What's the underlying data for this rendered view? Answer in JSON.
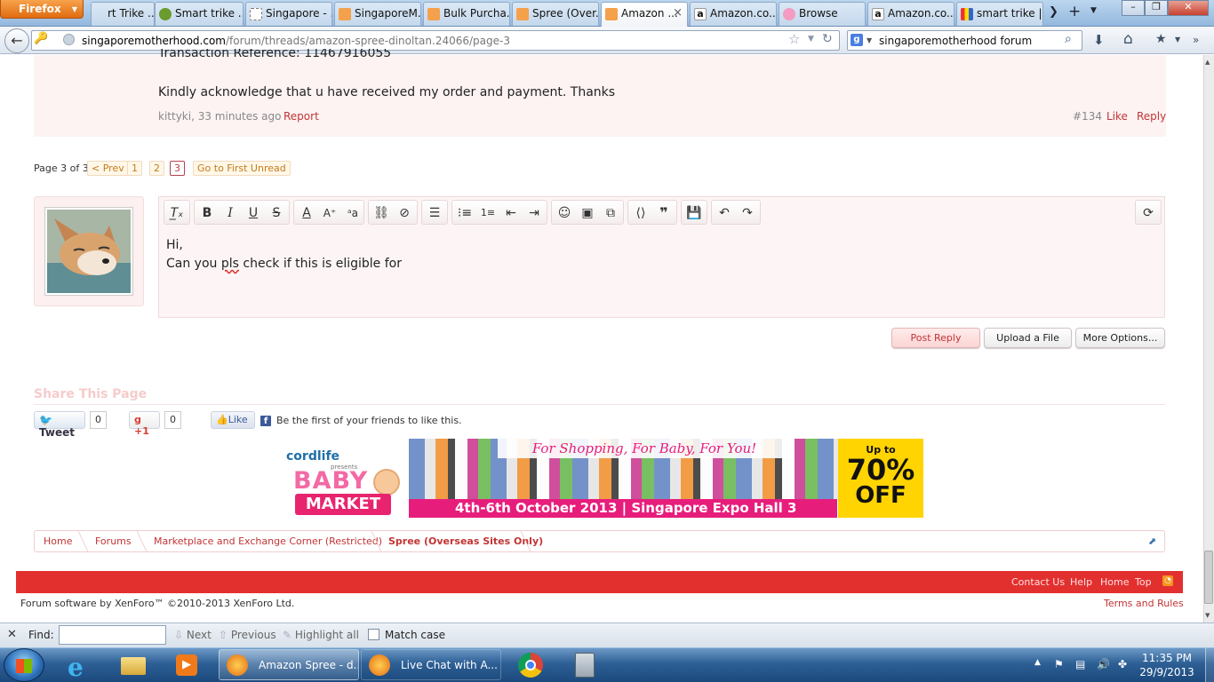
{
  "browser": {
    "app_menu": "Firefox",
    "tabs": [
      {
        "label": "rt Trike ...",
        "icon": "page-icon"
      },
      {
        "label": "Smart trike ...",
        "icon": "smarttrike-icon"
      },
      {
        "label": "Singapore - ...",
        "icon": "blank-page-icon"
      },
      {
        "label": "SingaporeM...",
        "icon": "forum-icon"
      },
      {
        "label": "Bulk Purcha...",
        "icon": "forum-icon"
      },
      {
        "label": "Spree (Over...",
        "icon": "forum-icon"
      },
      {
        "label": "Amazon ...",
        "icon": "forum-icon"
      },
      {
        "label": "Amazon.co...",
        "icon": "amazon-icon"
      },
      {
        "label": "Browse",
        "icon": "pig-icon"
      },
      {
        "label": "Amazon.co...",
        "icon": "amazon-icon"
      },
      {
        "label": "smart trike |...",
        "icon": "shop-icon"
      }
    ],
    "url_host": "singaporemotherhood.com",
    "url_path": "/forum/threads/amazon-spree-dinoltan.24066/page-3",
    "search_value": "singaporemotherhood forum"
  },
  "post": {
    "partial_line": "Transaction Reference: 11467916055",
    "body": "Kindly acknowledge that u have received my order and payment. Thanks",
    "author_time": "kittyki, 33 minutes ago",
    "report": "Report",
    "number": "#134",
    "like": "Like",
    "reply": "Reply"
  },
  "pagination": {
    "label": "Page 3 of 3",
    "prev": "< Prev",
    "pages": [
      "1",
      "2",
      "3"
    ],
    "first_unread": "Go to First Unread"
  },
  "editor": {
    "line1": "Hi,",
    "line2_before": "Can you ",
    "line2_misspelled": "pls",
    "line2_after": " check if this is eligible for"
  },
  "buttons": {
    "post_reply": "Post Reply",
    "upload": "Upload a File",
    "more": "More Options..."
  },
  "share": {
    "title": "Share This Page",
    "tweet": "Tweet",
    "tweet_count": "0",
    "gplus": "+1",
    "gplus_count": "0",
    "fb_like": "Like",
    "fb_text": "Be the first of your friends to like this."
  },
  "banner": {
    "brand": "cordlife",
    "presents": "presents",
    "baby": "BABY",
    "market": "MARKET",
    "slogan": "For Shopping, For Baby, For You!",
    "date_venue": "4th-6th October 2013  |  Singapore Expo Hall 3",
    "upto": "Up to",
    "discount": "70%",
    "off": "OFF"
  },
  "breadcrumb": [
    "Home",
    "Forums",
    "Marketplace and Exchange Corner (Restricted)",
    "Spree (Overseas Sites Only)"
  ],
  "footer": {
    "links": [
      "Contact Us",
      "Help",
      "Home",
      "Top"
    ],
    "copyright": "Forum software by XenForo™ ©2010-2013 XenForo Ltd.",
    "terms": "Terms and Rules"
  },
  "findbar": {
    "label": "Find:",
    "value": "",
    "next": "Next",
    "previous": "Previous",
    "highlight": "Highlight all",
    "match_case": "Match case"
  },
  "taskbar": {
    "tasks": [
      "Amazon Spree - d...",
      "Live Chat with A..."
    ],
    "time": "11:35 PM",
    "date": "29/9/2013"
  },
  "colors": {
    "accent": "#c23434",
    "footer_bar": "#e2302f",
    "banner_pink": "#e71d7c",
    "banner_yellow": "#ffd400"
  }
}
